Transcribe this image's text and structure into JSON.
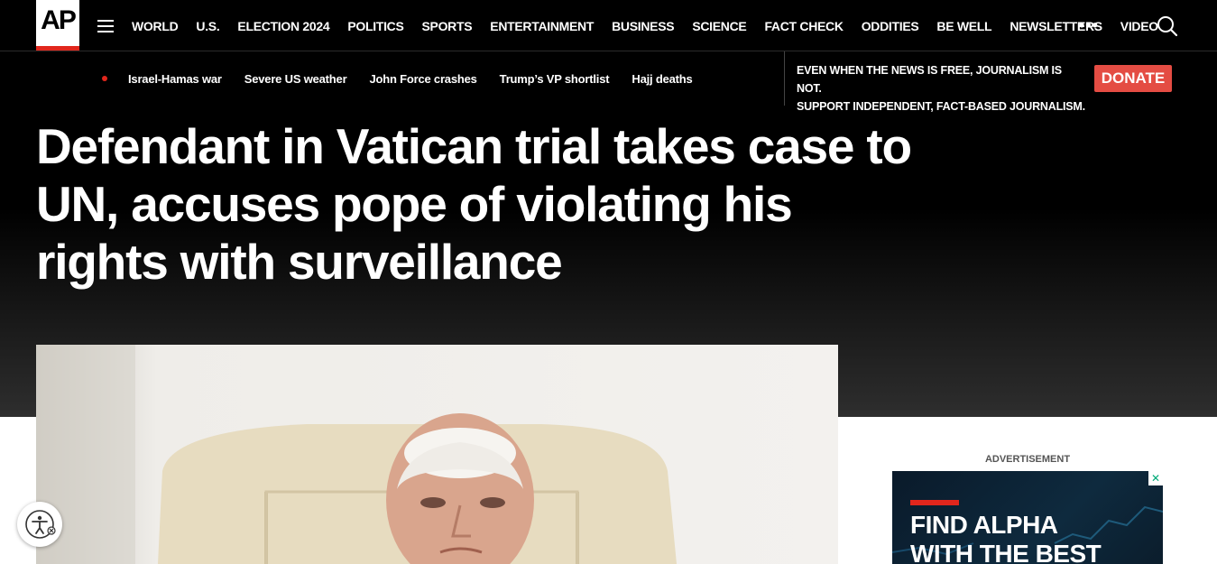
{
  "logo": {
    "text": "AP"
  },
  "nav": {
    "links": [
      "WORLD",
      "U.S.",
      "ELECTION 2024",
      "POLITICS",
      "SPORTS",
      "ENTERTAINMENT",
      "BUSINESS",
      "SCIENCE",
      "FACT CHECK",
      "ODDITIES",
      "BE WELL",
      "NEWSLETTERS",
      "VIDEO"
    ],
    "more": "•••"
  },
  "trending": [
    "Israel-Hamas war",
    "Severe US weather",
    "John Force crashes",
    "Trump’s VP shortlist",
    "Hajj deaths"
  ],
  "promo": {
    "line1": "EVEN WHEN THE NEWS IS FREE, JOURNALISM IS NOT.",
    "line2": "SUPPORT INDEPENDENT, FACT-BASED JOURNALISM.",
    "donate": "DONATE"
  },
  "article": {
    "headline": "Defendant in Vatican trial takes case to UN, accuses pope of violating his rights with surveillance"
  },
  "ad": {
    "label": "ADVERTISEMENT",
    "line1": "FIND ALPHA",
    "line2": "WITH THE BEST",
    "close": "✕"
  },
  "colors": {
    "accent": "#e1261c",
    "donate": "#e44c43"
  }
}
